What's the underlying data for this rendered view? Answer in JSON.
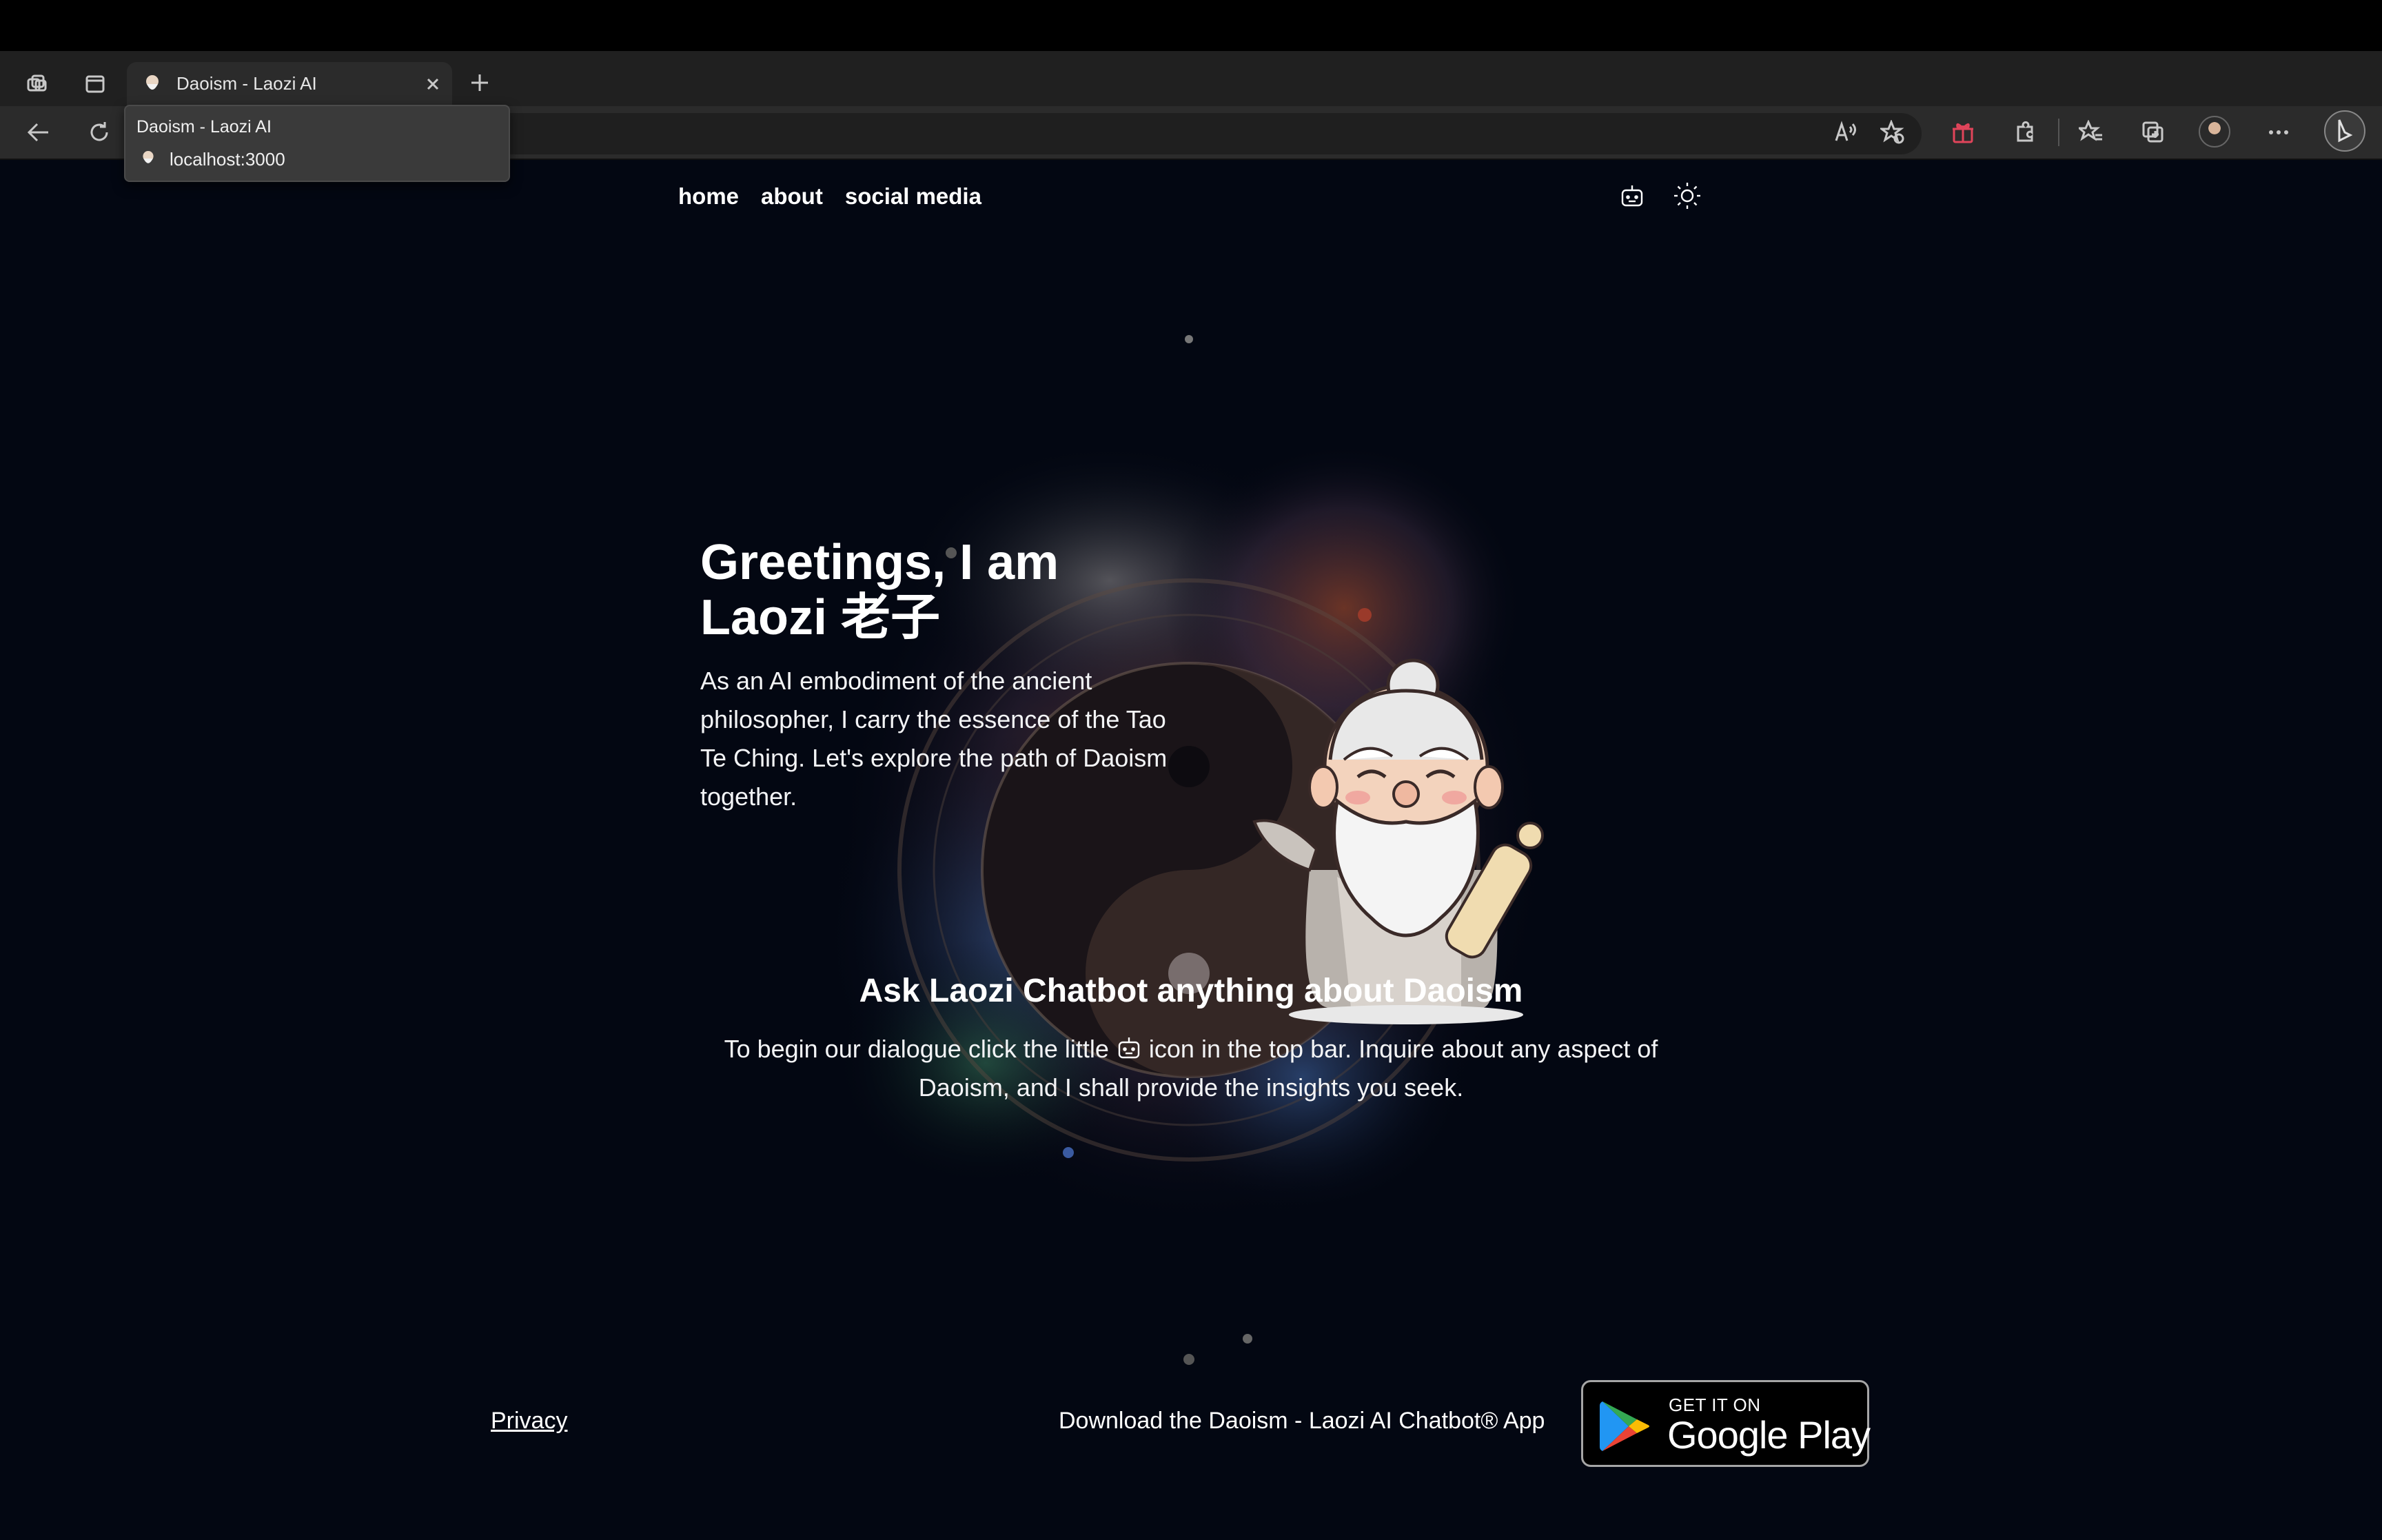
{
  "browser": {
    "tab_title": "Daoism - Laozi AI",
    "tooltip_title": "Daoism - Laozi AI",
    "tooltip_url": "localhost:3000",
    "toolbar_icons": [
      "workspaces-icon",
      "tab-actions-icon",
      "back-icon",
      "refresh-icon",
      "read-aloud-icon",
      "add-favorite-icon",
      "gift-icon",
      "extensions-icon",
      "favorites-icon",
      "collections-icon",
      "profile-avatar",
      "more-icon",
      "bing-chat-icon"
    ]
  },
  "nav": {
    "home": "home",
    "about": "about",
    "social": "social media"
  },
  "hero": {
    "title_line1": "Greetings, I am",
    "title_line2": "Laozi 老子",
    "description": "As an AI embodiment of the ancient philosopher, I carry the essence of the Tao Te Ching. Let's explore the path of Daoism together."
  },
  "ask": {
    "title": "Ask Laozi Chatbot anything about Daoism",
    "text_before": "To begin our dialogue click the little",
    "text_after": "icon in the top bar. Inquire about any aspect of Daoism, and I shall provide the insights you seek."
  },
  "footer": {
    "privacy": "Privacy",
    "download": "Download the Daoism - Laozi AI Chatbot® App",
    "badge_small": "GET IT ON",
    "badge_big": "Google Play"
  },
  "colors": {
    "page_bg": "#030712",
    "text": "#ffffff",
    "gift_accent": "#e0445a"
  }
}
